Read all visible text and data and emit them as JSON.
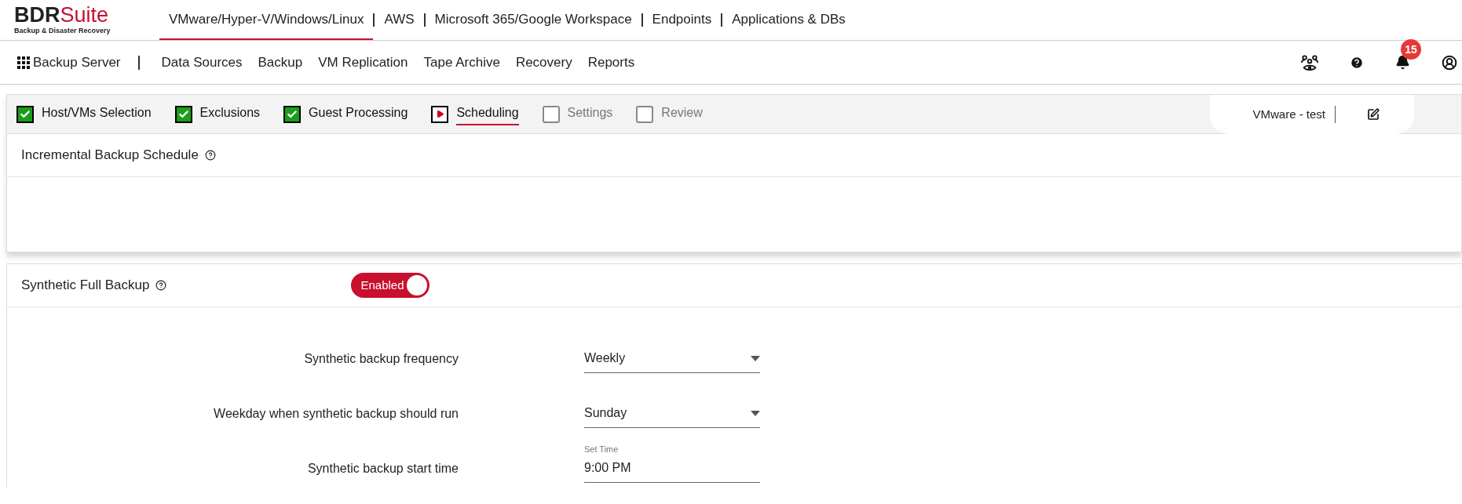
{
  "logo": {
    "text_1": "BDR",
    "text_2": "Suite",
    "tagline": "Backup & Disaster Recovery"
  },
  "top_nav": [
    {
      "label": "VMware/Hyper-V/Windows/Linux",
      "selected": true
    },
    {
      "label": "AWS",
      "selected": false
    },
    {
      "label": "Microsoft 365/Google Workspace",
      "selected": false
    },
    {
      "label": "Endpoints",
      "selected": false
    },
    {
      "label": "Applications & DBs",
      "selected": false
    }
  ],
  "app_menu": {
    "label": "Backup Server",
    "items": [
      "Data Sources",
      "Backup",
      "VM Replication",
      "Tape Archive",
      "Recovery",
      "Reports"
    ]
  },
  "notifications": {
    "count": "15"
  },
  "steps": [
    {
      "label": "Host/VMs Selection",
      "kind": "done",
      "selected": false
    },
    {
      "label": "Exclusions",
      "kind": "done",
      "selected": false
    },
    {
      "label": "Guest Processing",
      "kind": "done",
      "selected": false
    },
    {
      "label": "Scheduling",
      "kind": "current",
      "selected": true
    },
    {
      "label": "Settings",
      "kind": "pending",
      "selected": false
    },
    {
      "label": "Review",
      "kind": "pending",
      "selected": false
    }
  ],
  "job_name": "VMware - test",
  "incremental": {
    "title": "Incremental Backup Schedule"
  },
  "synthetic": {
    "title": "Synthetic Full Backup",
    "toggle": {
      "label": "Enabled",
      "on": true
    },
    "fields": [
      {
        "kind": "select",
        "label": "Synthetic backup frequency",
        "value": "Weekly"
      },
      {
        "kind": "select",
        "label": "Weekday when synthetic backup should run",
        "value": "Sunday"
      },
      {
        "kind": "time",
        "label": "Synthetic backup start time",
        "caption": "Set Time",
        "value": "9:00 PM"
      }
    ]
  }
}
